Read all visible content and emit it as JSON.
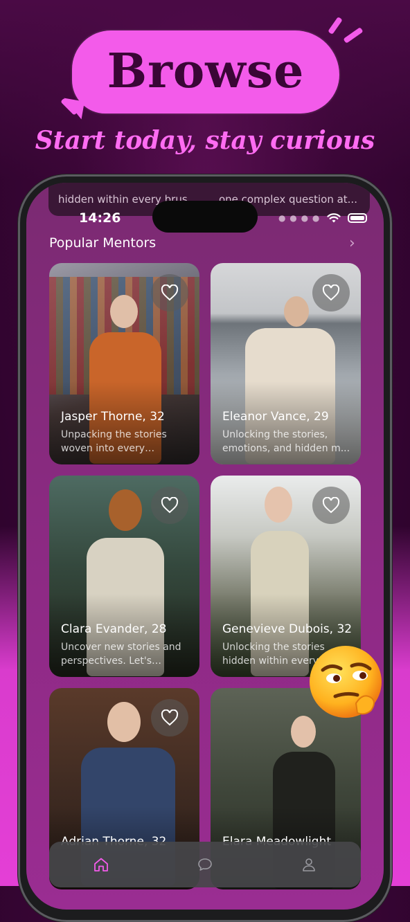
{
  "promo": {
    "headline": "Browse",
    "subline": "Start today, stay curious"
  },
  "status_bar": {
    "time": "14:26"
  },
  "peek_cards": [
    {
      "text": "hidden within every brus"
    },
    {
      "text": "one complex question at..."
    }
  ],
  "section": {
    "title": "Popular Mentors"
  },
  "mentors": [
    {
      "name": "Jasper Thorne, 32",
      "description": "Unpacking the stories woven into every brushs..."
    },
    {
      "name": "Eleanor Vance, 29",
      "description": "Unlocking the stories, emotions, and hidden m..."
    },
    {
      "name": "Clara Evander, 28",
      "description": "Uncover new stories and perspectives. Let's delve..."
    },
    {
      "name": "Genevieve Dubois, 32",
      "description": "Unlocking the stories hidden within every b..."
    },
    {
      "name": "Adrian Thorne, 32",
      "description": ""
    },
    {
      "name": "Elara Meadowlight",
      "description": ""
    }
  ],
  "tabbar": {
    "active": "home",
    "items": [
      "home-icon",
      "chat-icon",
      "profile-icon"
    ]
  },
  "colors": {
    "accent_pink": "#f35bea",
    "background": "#3a0636",
    "card_overlay": "#000000"
  }
}
